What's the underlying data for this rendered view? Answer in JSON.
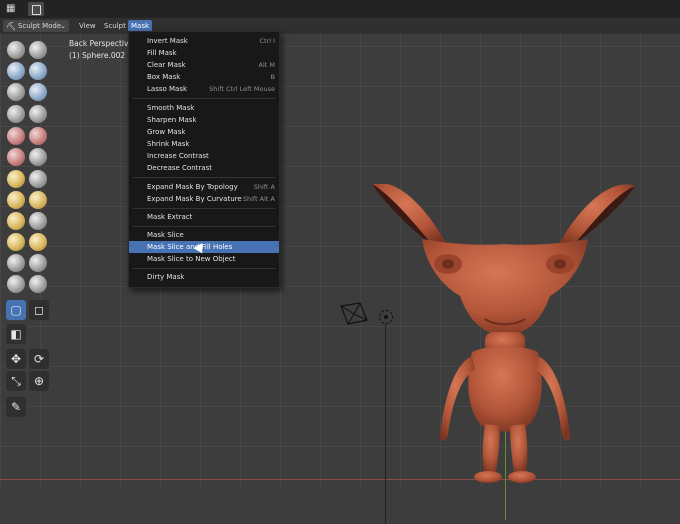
{
  "topbar": {
    "editor_icon": "editor-type-icon",
    "scene_icon": "scene-icon"
  },
  "header": {
    "mode": "Sculpt Mode",
    "menus": [
      "View",
      "Sculpt",
      "Mask"
    ]
  },
  "viewport": {
    "view_name": "Back Perspective",
    "object_name": "(1) Sphere.002"
  },
  "mask_menu": {
    "items": [
      {
        "label": "Invert Mask",
        "shortcut": "Ctrl I"
      },
      {
        "label": "Fill Mask",
        "shortcut": ""
      },
      {
        "label": "Clear Mask",
        "shortcut": "Alt M"
      },
      {
        "label": "Box Mask",
        "shortcut": "B"
      },
      {
        "label": "Lasso Mask",
        "shortcut": "Shift Ctrl Left Mouse"
      },
      {
        "label": "Smooth Mask",
        "shortcut": ""
      },
      {
        "label": "Sharpen Mask",
        "shortcut": ""
      },
      {
        "label": "Grow Mask",
        "shortcut": ""
      },
      {
        "label": "Shrink Mask",
        "shortcut": ""
      },
      {
        "label": "Increase Contrast",
        "shortcut": ""
      },
      {
        "label": "Decrease Contrast",
        "shortcut": ""
      },
      {
        "label": "Expand Mask By Topology",
        "shortcut": "Shift A"
      },
      {
        "label": "Expand Mask By Curvature",
        "shortcut": "Shift Alt A"
      },
      {
        "label": "Mask Extract",
        "shortcut": ""
      },
      {
        "label": "Mask Slice",
        "shortcut": ""
      },
      {
        "label": "Mask Slice and Fill Holes",
        "shortcut": ""
      },
      {
        "label": "Mask Slice to New Object",
        "shortcut": ""
      },
      {
        "label": "Dirty Mask",
        "shortcut": ""
      }
    ],
    "highlighted": "Mask Slice and Fill Holes"
  },
  "colors": {
    "accent": "#4772b3",
    "menu_bg": "#181818",
    "viewport_bg": "#3d3d3d",
    "model_skin": "#b85a3c"
  }
}
